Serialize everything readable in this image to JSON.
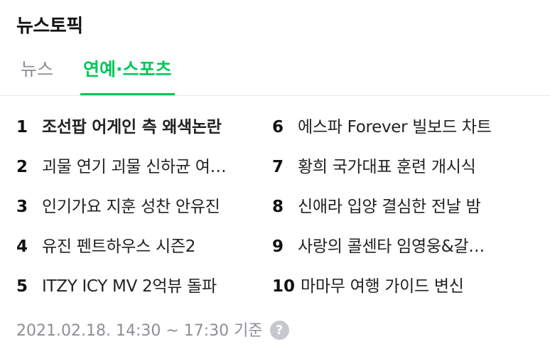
{
  "title": "뉴스토픽",
  "tabs": [
    {
      "label": "뉴스"
    },
    {
      "label": "연예·스포츠"
    }
  ],
  "items": [
    {
      "rank": "1",
      "text": "조선팝 어게인 측 왜색논란"
    },
    {
      "rank": "2",
      "text": "괴물 연기 괴물 신하균 여진구"
    },
    {
      "rank": "3",
      "text": "인기가요 지훈 성찬 안유진"
    },
    {
      "rank": "4",
      "text": "유진 펜트하우스 시즌2"
    },
    {
      "rank": "5",
      "text": "ITZY ICY MV 2억뷰 돌파"
    },
    {
      "rank": "6",
      "text": "에스파 Forever 빌보드 차트"
    },
    {
      "rank": "7",
      "text": "황희 국가대표 훈련 개시식"
    },
    {
      "rank": "8",
      "text": "신애라 입양 결심한 전날 밤"
    },
    {
      "rank": "9",
      "text": "사랑의 콜센타 임영웅&갈라쇼"
    },
    {
      "rank": "10",
      "text": "마마무 여행 가이드 변신"
    }
  ],
  "footer": {
    "timestamp": "2021.02.18. 14:30 ~ 17:30 기준",
    "help_icon": "question-mark-icon",
    "help_glyph": "?"
  },
  "colors": {
    "accent": "#03c75a",
    "muted": "#8c8f94",
    "text": "#222222"
  }
}
